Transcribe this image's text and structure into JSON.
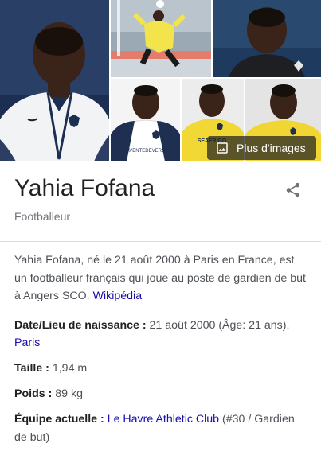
{
  "knowledge_panel": {
    "gallery": {
      "more_images_label": "Plus d'images",
      "tiles": [
        {
          "name": "photo-france-jacket"
        },
        {
          "name": "photo-goalkeeper-save"
        },
        {
          "name": "photo-portrait-dark"
        },
        {
          "name": "photo-le-havre-white-kit"
        },
        {
          "name": "photo-yellow-kit-1"
        },
        {
          "name": "photo-yellow-kit-2"
        }
      ],
      "kit_texts": {
        "white": "HAVENTEDEVERGE",
        "yellow": "SEAFRIGO"
      }
    },
    "title": "Yahia Fofana",
    "subtitle": "Footballeur",
    "share_icon": "share-icon",
    "description": {
      "text": "Yahia Fofana, né le 21 août 2000 à Paris en France, est un footballeur français qui joue au poste de gardien de but à Angers SCO.",
      "source_link": "Wikipédia"
    },
    "facts": {
      "birth": {
        "label": "Date/Lieu de naissance :",
        "value": "21 août 2000 (Âge: 21 ans),",
        "link": "Paris"
      },
      "height": {
        "label": "Taille :",
        "value": "1,94 m"
      },
      "weight": {
        "label": "Poids :",
        "value": "89 kg"
      },
      "team": {
        "label": "Équipe actuelle :",
        "link": "Le Havre Athletic Club",
        "value": "(#30 / Gardien de but)"
      }
    },
    "colors": {
      "link": "#1a0dab",
      "text": "#4d5156",
      "heading": "#202124",
      "muted": "#70757a"
    }
  }
}
